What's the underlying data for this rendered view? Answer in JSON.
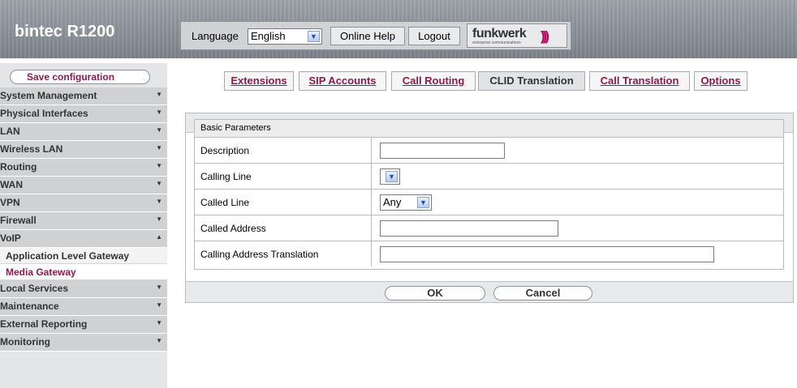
{
  "header": {
    "brand": "bintec R1200",
    "language_label": "Language",
    "language_value": "English",
    "online_help": "Online Help",
    "logout": "Logout",
    "logo_text": "funkwerk",
    "logo_sub": "enterprise communications"
  },
  "sidebar": {
    "save": "Save configuration",
    "items": [
      {
        "label": "System Management"
      },
      {
        "label": "Physical Interfaces"
      },
      {
        "label": "LAN"
      },
      {
        "label": "Wireless LAN"
      },
      {
        "label": "Routing"
      },
      {
        "label": "WAN"
      },
      {
        "label": "VPN"
      },
      {
        "label": "Firewall"
      },
      {
        "label": "VoIP"
      }
    ],
    "subitems": [
      {
        "label": "Application Level Gateway"
      },
      {
        "label": "Media Gateway"
      }
    ],
    "items_after": [
      {
        "label": "Local Services"
      },
      {
        "label": "Maintenance"
      },
      {
        "label": "External Reporting"
      },
      {
        "label": "Monitoring"
      }
    ]
  },
  "tabs": [
    {
      "label": "Extensions"
    },
    {
      "label": "SIP Accounts"
    },
    {
      "label": "Call Routing"
    },
    {
      "label": "CLID Translation"
    },
    {
      "label": "Call Translation"
    },
    {
      "label": "Options"
    }
  ],
  "form": {
    "section_title": "Basic Parameters",
    "rows": [
      {
        "label": "Description",
        "value": ""
      },
      {
        "label": "Calling Line",
        "value": ""
      },
      {
        "label": "Called Line",
        "value": "Any"
      },
      {
        "label": "Called Address",
        "value": ""
      },
      {
        "label": "Calling Address Translation",
        "value": ""
      }
    ],
    "ok": "OK",
    "cancel": "Cancel"
  },
  "colors": {
    "accent": "#8b1b4b",
    "header": "#8a9096",
    "sidebar": "#cfd1d3"
  }
}
